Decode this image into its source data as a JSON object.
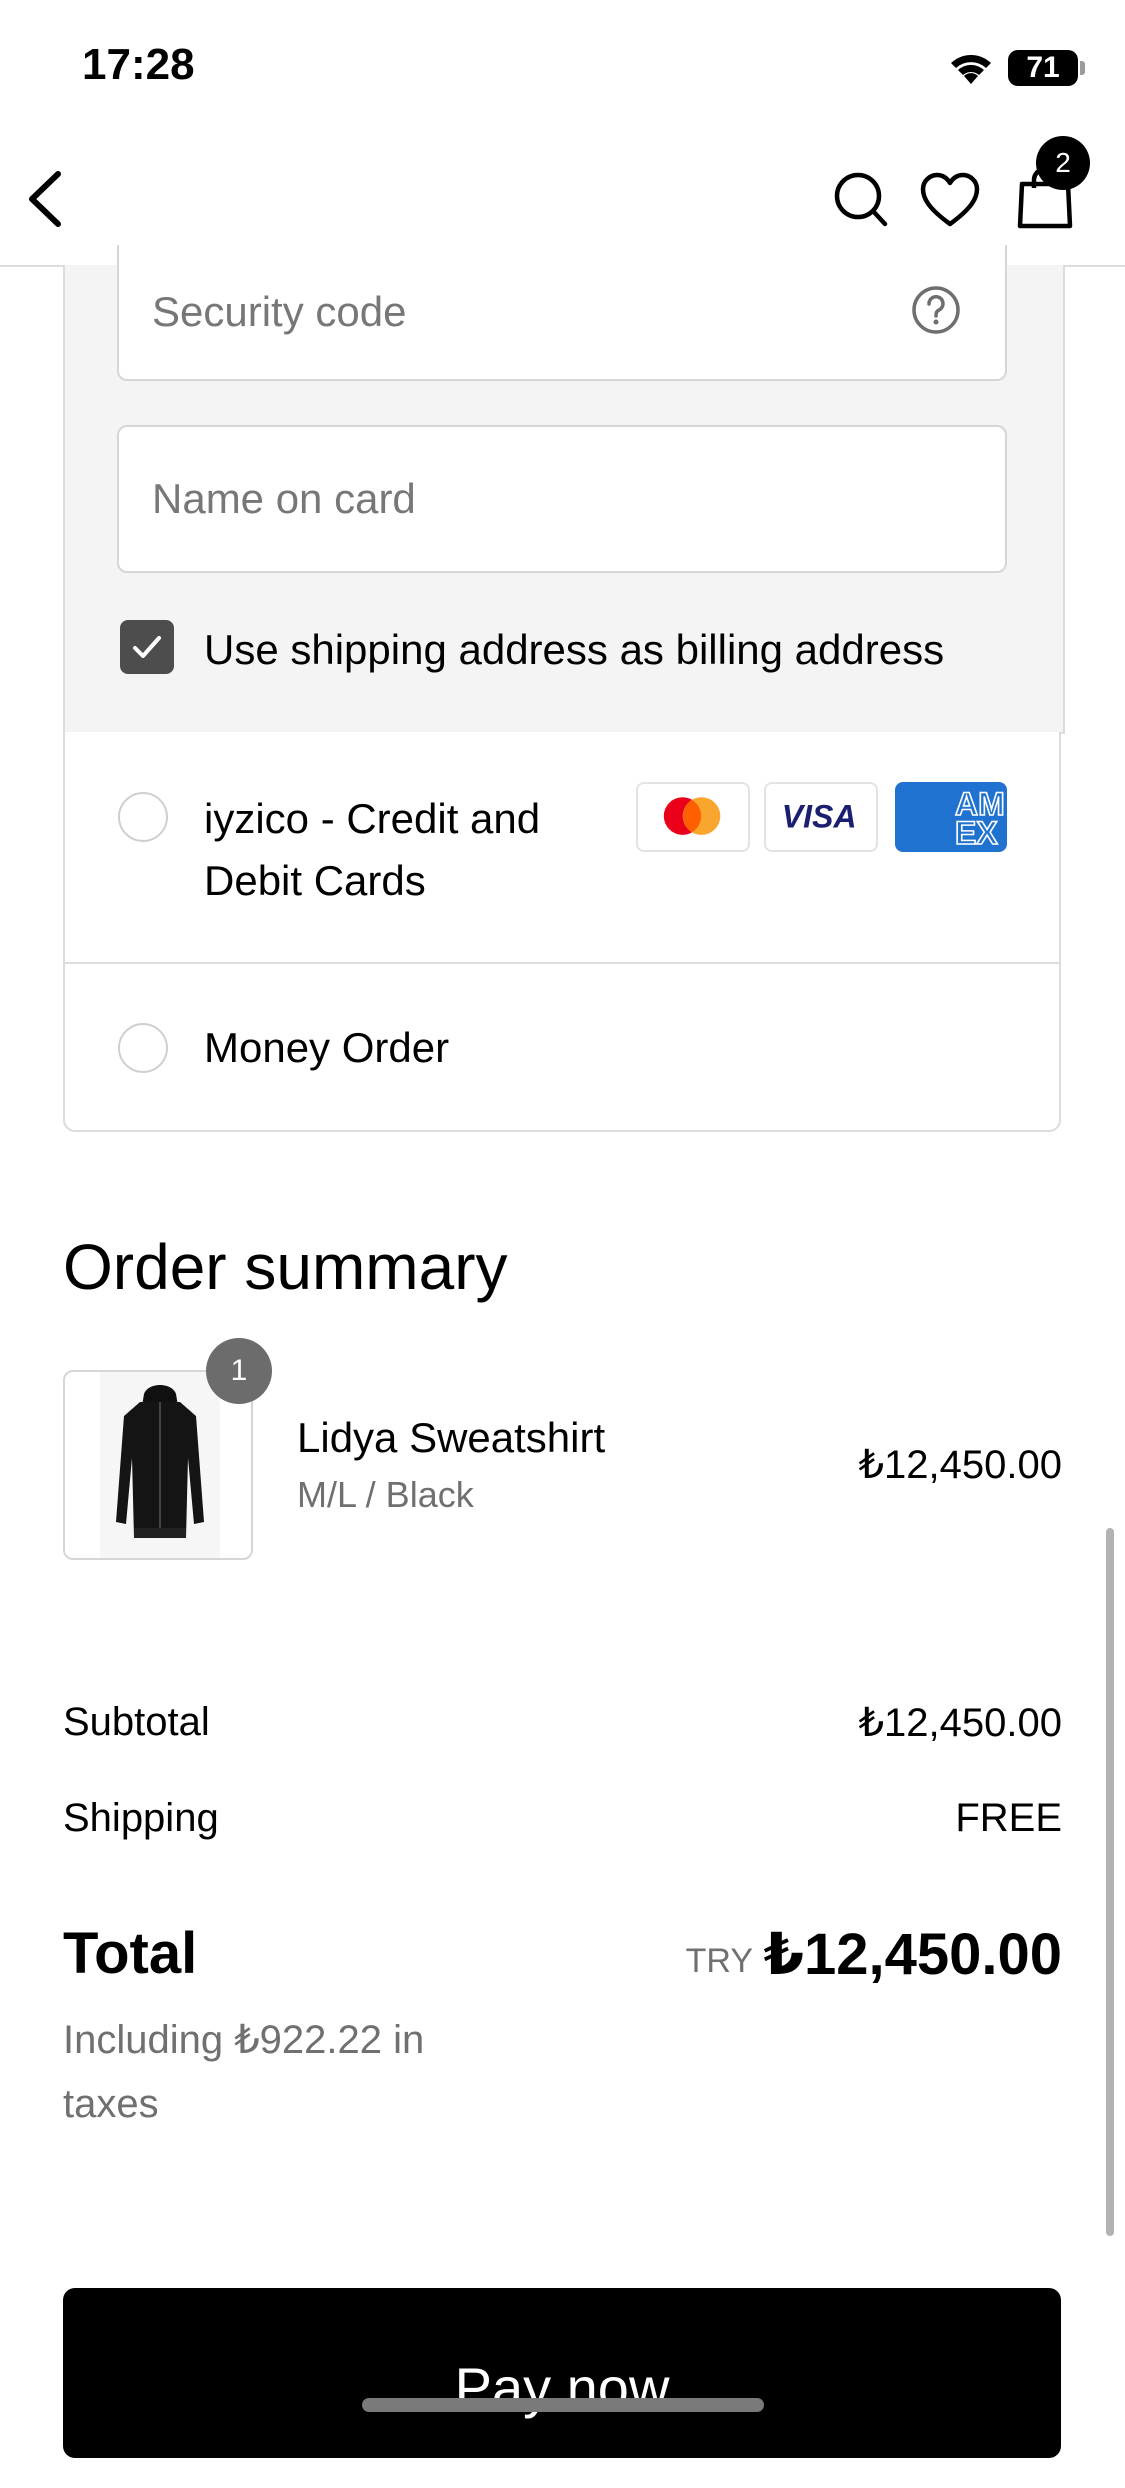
{
  "status_bar": {
    "time": "17:28",
    "battery": "71"
  },
  "header": {
    "cart_count": "2"
  },
  "payment_form": {
    "security_code_placeholder": "Security code",
    "name_on_card_placeholder": "Name on card",
    "billing_checkbox_label": "Use shipping address as billing address",
    "billing_checked": true
  },
  "payment_options": [
    {
      "label": "iyzico - Credit and Debit Cards",
      "cards": [
        "mastercard-logo",
        "visa-logo",
        "amex-logo"
      ],
      "visa_text": "VISA",
      "amex_text": "AM EX"
    },
    {
      "label": "Money Order"
    }
  ],
  "order_summary": {
    "title": "Order summary",
    "item": {
      "quantity": "1",
      "name": "Lidya Sweatshirt",
      "variant": "M/L / Black",
      "price": "₺12,450.00"
    },
    "subtotal_label": "Subtotal",
    "subtotal_value": "₺12,450.00",
    "shipping_label": "Shipping",
    "shipping_value": "FREE",
    "total_label": "Total",
    "total_currency": "TRY",
    "total_value": "₺12,450.00",
    "taxes_note": "Including ₺922.22 in taxes"
  },
  "pay_button_label": "Pay now",
  "colors": {
    "amex_blue": "#1f72cf",
    "mastercard_red": "#eb001b",
    "mastercard_orange": "#f79e1b",
    "visa_navy": "#1a1f71"
  }
}
